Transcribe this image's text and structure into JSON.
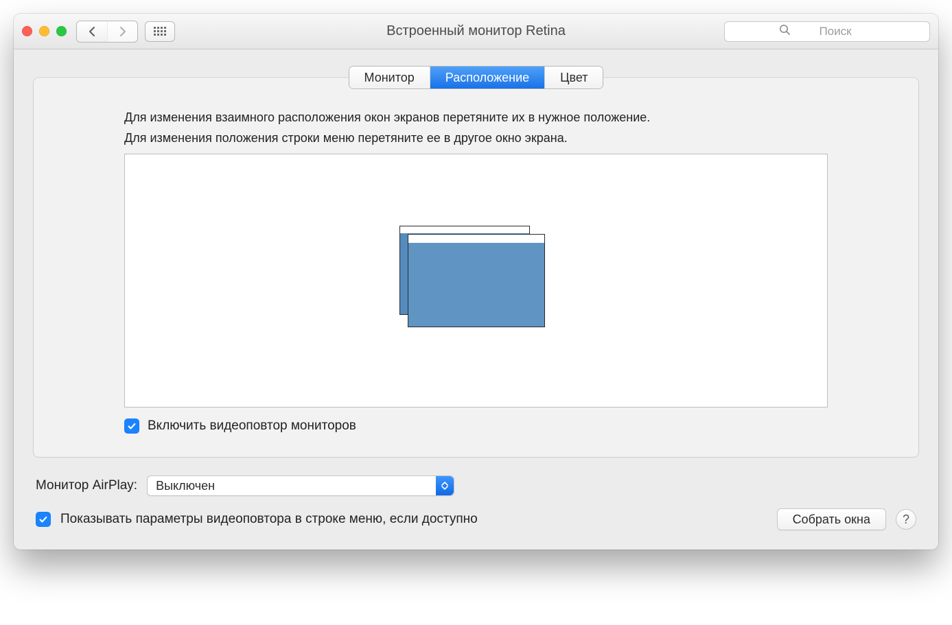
{
  "window": {
    "title": "Встроенный монитор Retina"
  },
  "search": {
    "placeholder": "Поиск"
  },
  "tabs": [
    {
      "label": "Монитор",
      "active": false
    },
    {
      "label": "Расположение",
      "active": true
    },
    {
      "label": "Цвет",
      "active": false
    }
  ],
  "panel": {
    "instruction_line1": "Для изменения взаимного расположения окон экранов перетяните их в нужное положение.",
    "instruction_line2": "Для изменения положения строки меню перетяните ее в другое окно экрана.",
    "mirror_checkbox": {
      "checked": true,
      "label": "Включить видеоповтор мониторов"
    }
  },
  "airplay": {
    "label": "Монитор AirPlay:",
    "selected": "Выключен"
  },
  "show_mirroring": {
    "checked": true,
    "label": "Показывать параметры видеоповтора в строке меню, если доступно"
  },
  "buttons": {
    "gather_windows": "Собрать окна",
    "help": "?"
  }
}
